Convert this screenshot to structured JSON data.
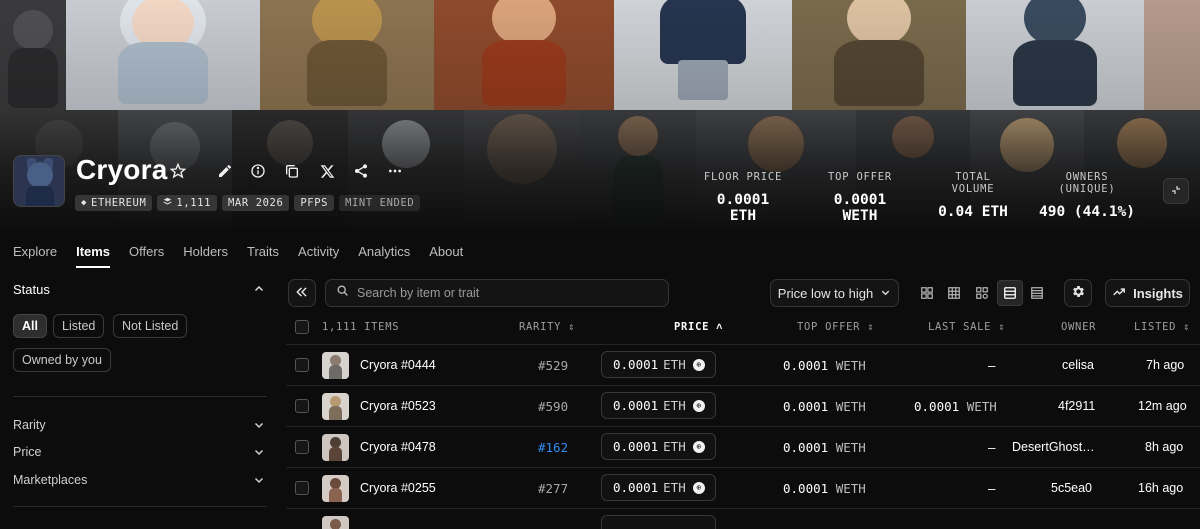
{
  "collection": {
    "name": "Cryora",
    "tags": [
      {
        "label": "ETHEREUM",
        "icon": "ethereum-icon"
      },
      {
        "label": "1,111",
        "icon": "layers-icon"
      },
      {
        "label": "MAR 2026"
      },
      {
        "label": "PFPS"
      },
      {
        "label": "MINT ENDED"
      }
    ],
    "stats": [
      {
        "label": "FLOOR PRICE",
        "value": "0.0001 ETH"
      },
      {
        "label": "TOP OFFER",
        "value": "0.0001 WETH"
      },
      {
        "label": "TOTAL VOLUME",
        "value": "0.04 ETH"
      },
      {
        "label": "OWNERS (UNIQUE)",
        "value": "490 (44.1%)"
      }
    ],
    "header_icons": [
      "star-icon",
      "pencil-icon",
      "info-icon",
      "copy-icon",
      "x-logo-icon",
      "share-icon",
      "more-icon"
    ]
  },
  "tabs": [
    "Explore",
    "Items",
    "Offers",
    "Holders",
    "Traits",
    "Activity",
    "Analytics",
    "About"
  ],
  "active_tab": "Items",
  "sidebar": {
    "status_title": "Status",
    "status_options": [
      "All",
      "Listed",
      "Not Listed",
      "Owned by you"
    ],
    "status_active": "All",
    "filters": [
      "Rarity",
      "Price",
      "Marketplaces"
    ]
  },
  "toolbar": {
    "search_placeholder": "Search by item or trait",
    "sort_label": "Price low to high",
    "insights_label": "Insights"
  },
  "table": {
    "headers": {
      "items": "1,111 ITEMS",
      "rarity": "RARITY",
      "price": "PRICE",
      "top_offer": "TOP OFFER",
      "last_sale": "LAST SALE",
      "owner": "OWNER",
      "listed": "LISTED"
    },
    "rows": [
      {
        "name": "Cryora #0444",
        "rarity": "#529",
        "price": "0.0001",
        "price_unit": "ETH",
        "top_offer": "0.0001",
        "top_offer_unit": "WETH",
        "last_sale": "–",
        "last_sale_unit": "",
        "owner": "celisa",
        "listed": "7h ago",
        "rarity_highlight": false
      },
      {
        "name": "Cryora #0523",
        "rarity": "#590",
        "price": "0.0001",
        "price_unit": "ETH",
        "top_offer": "0.0001",
        "top_offer_unit": "WETH",
        "last_sale": "0.0001",
        "last_sale_unit": "WETH",
        "owner": "4f2911",
        "listed": "12m ago",
        "rarity_highlight": false
      },
      {
        "name": "Cryora #0478",
        "rarity": "#162",
        "price": "0.0001",
        "price_unit": "ETH",
        "top_offer": "0.0001",
        "top_offer_unit": "WETH",
        "last_sale": "–",
        "last_sale_unit": "",
        "owner": "DesertGhost…",
        "listed": "8h ago",
        "rarity_highlight": true
      },
      {
        "name": "Cryora #0255",
        "rarity": "#277",
        "price": "0.0001",
        "price_unit": "ETH",
        "top_offer": "0.0001",
        "top_offer_unit": "WETH",
        "last_sale": "–",
        "last_sale_unit": "",
        "owner": "5c5ea0",
        "listed": "16h ago",
        "rarity_highlight": false
      }
    ]
  },
  "colors": {
    "background": "#0c0c0c",
    "accent_link": "#2f8cf0",
    "text": "#e8e8e8"
  }
}
